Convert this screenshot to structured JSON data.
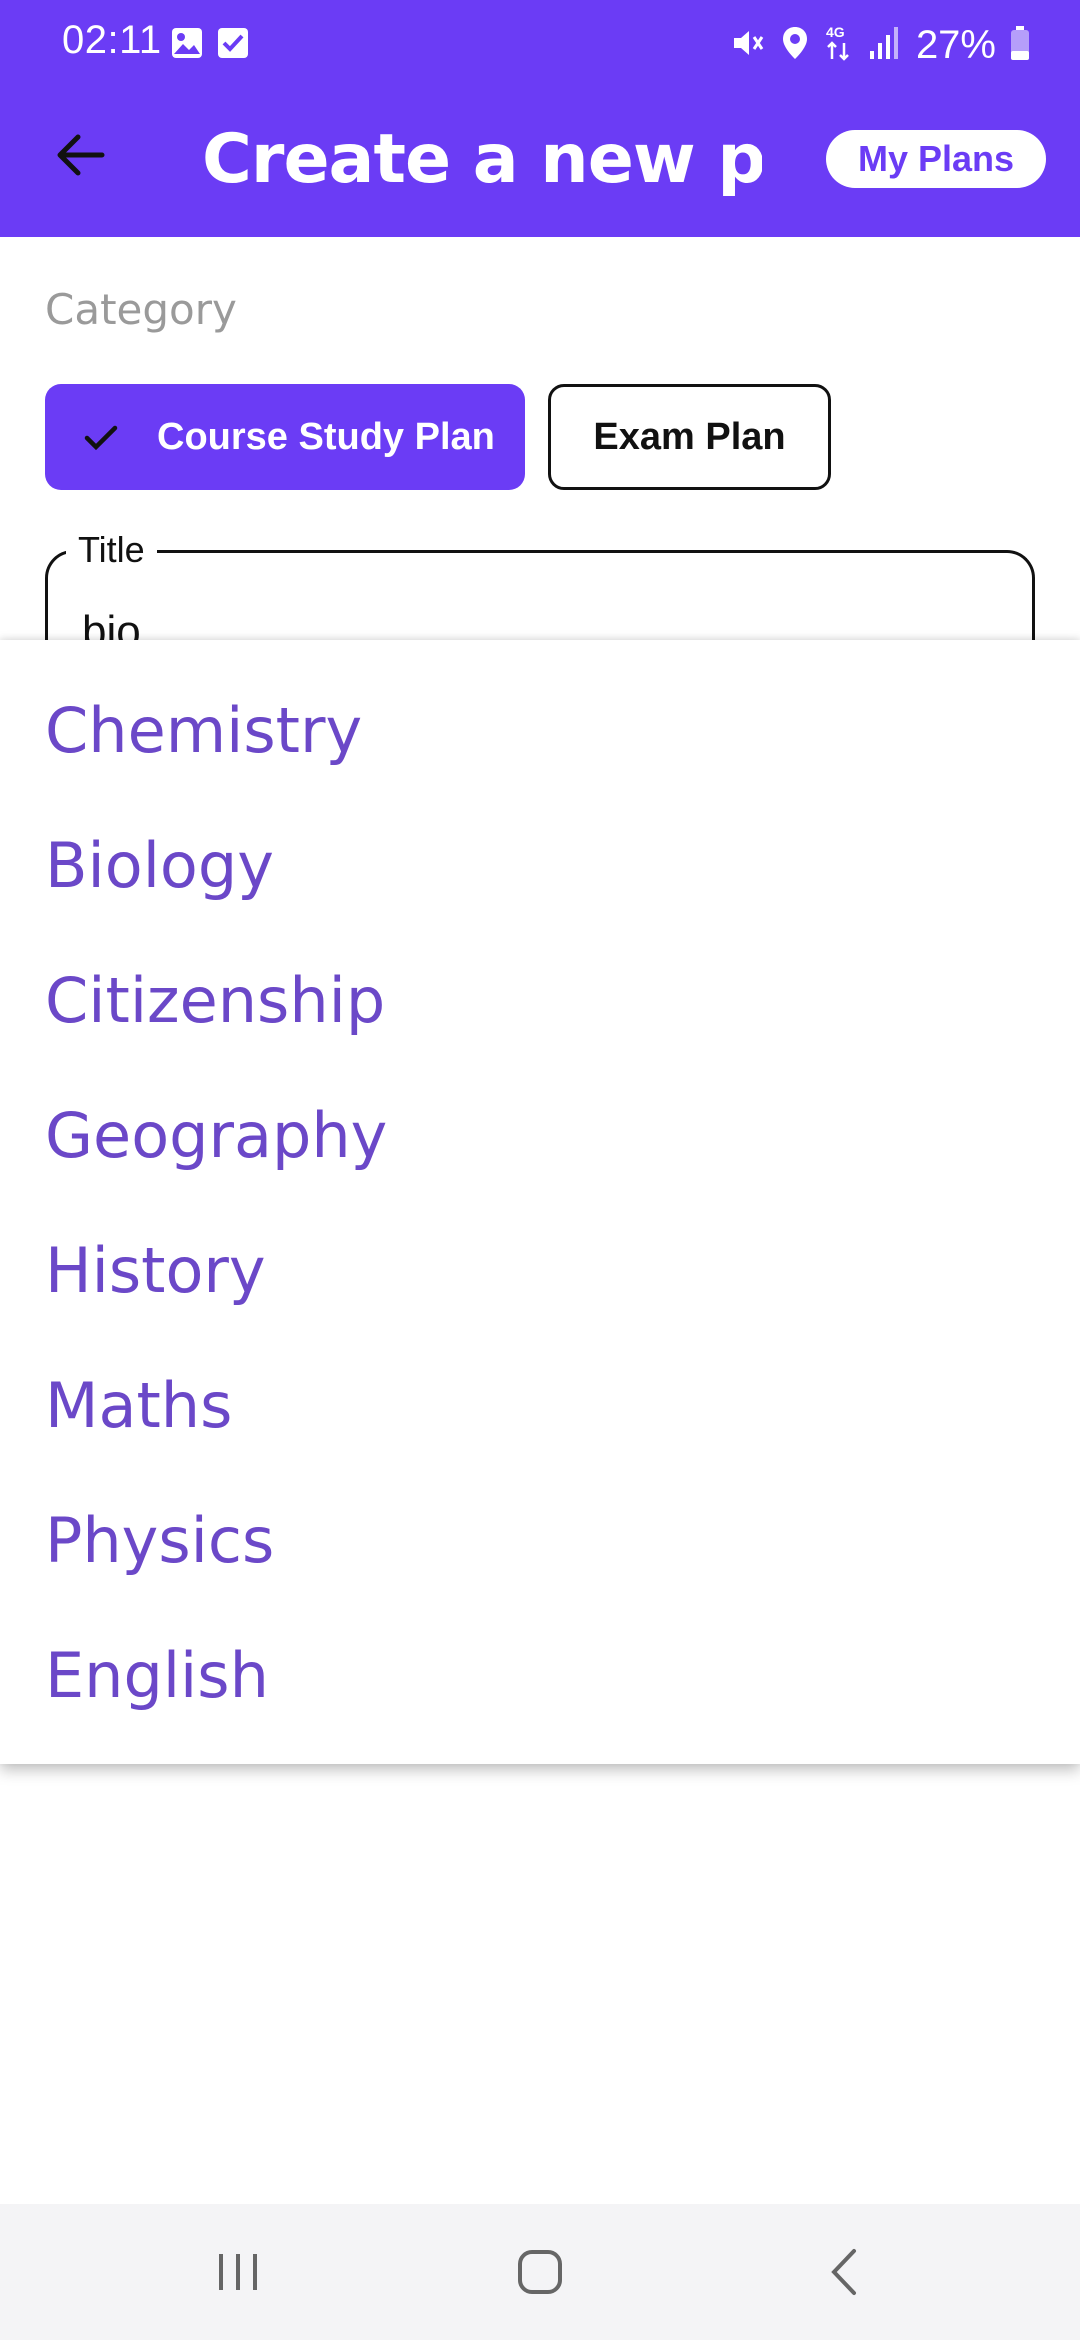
{
  "status_bar": {
    "time": "02:11",
    "battery": "27%"
  },
  "app_bar": {
    "title": "Create a new pl...",
    "my_plans_label": "My Plans"
  },
  "form": {
    "category_label": "Category",
    "chips": [
      {
        "label": "Course Study Plan",
        "selected": true
      },
      {
        "label": "Exam Plan",
        "selected": false
      }
    ],
    "title_field": {
      "label": "Title",
      "value": "bio"
    }
  },
  "dropdown": {
    "options": [
      "Chemistry",
      "Biology",
      "Citizenship",
      "Geography",
      "History",
      "Maths",
      "Physics",
      "English"
    ]
  },
  "colors": {
    "primary": "#6b3cf5",
    "option_text": "#6b48c8"
  }
}
